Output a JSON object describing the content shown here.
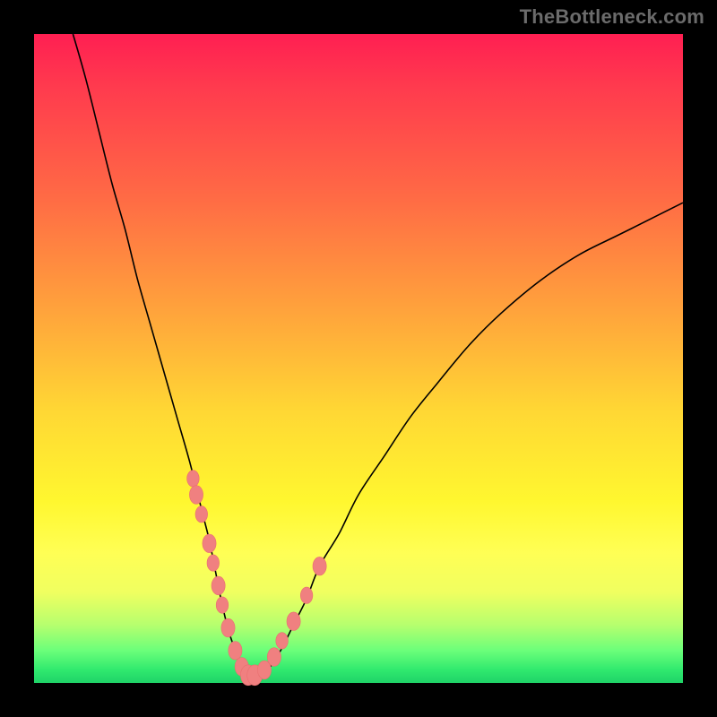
{
  "watermark": "TheBottleneck.com",
  "colors": {
    "frame": "#000000",
    "gradient_top": "#ff1f52",
    "gradient_mid1": "#ffa13c",
    "gradient_mid2": "#fff72f",
    "gradient_bottom": "#1fd368",
    "curve": "#000000",
    "dots": "#f08080"
  },
  "chart_data": {
    "type": "line",
    "title": "",
    "xlabel": "",
    "ylabel": "",
    "xlim": [
      0,
      100
    ],
    "ylim": [
      0,
      100
    ],
    "series": [
      {
        "name": "bottleneck-curve",
        "x": [
          6,
          8,
          10,
          12,
          14,
          16,
          18,
          20,
          22,
          24,
          26,
          27,
          28,
          29,
          30,
          31,
          32,
          33,
          34,
          36,
          38,
          40,
          42,
          44,
          47,
          50,
          54,
          58,
          62,
          67,
          72,
          78,
          84,
          90,
          96,
          100
        ],
        "y": [
          100,
          93,
          85,
          77,
          70,
          62,
          55,
          48,
          41,
          34,
          26,
          22,
          17,
          12,
          8,
          5,
          2,
          1,
          1,
          2,
          5,
          9,
          13,
          18,
          23,
          29,
          35,
          41,
          46,
          52,
          57,
          62,
          66,
          69,
          72,
          74
        ]
      }
    ],
    "highlight_points": {
      "name": "zone-dots",
      "x": [
        24.5,
        25.0,
        25.8,
        27.0,
        27.6,
        28.4,
        29.0,
        29.9,
        31.0,
        32.0,
        33.0,
        34.0,
        35.5,
        37.0,
        38.2,
        40.0,
        42.0,
        44.0
      ],
      "y": [
        31.5,
        29.0,
        26.0,
        21.5,
        18.5,
        15.0,
        12.0,
        8.5,
        5.0,
        2.5,
        1.2,
        1.2,
        2.0,
        4.0,
        6.5,
        9.5,
        13.5,
        18.0
      ],
      "r": [
        8,
        9,
        8,
        9,
        8,
        9,
        8,
        9,
        9,
        9,
        10,
        10,
        9,
        9,
        8,
        9,
        8,
        9
      ]
    }
  }
}
